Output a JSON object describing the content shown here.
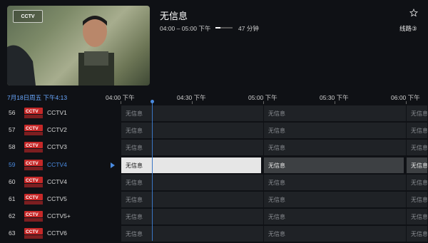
{
  "player": {
    "title": "无信息",
    "time_range": "04:00 – 05:00 下午",
    "progress_fraction": 0.3,
    "duration": "47 分钟",
    "line_label": "线路③",
    "star_icon": "star-outline-icon"
  },
  "timeline": {
    "date": "7月18日周五 下午4:13",
    "ticks": [
      "04:00 下午",
      "04:30 下午",
      "05:00 下午",
      "05:30 下午",
      "06:00 下午"
    ]
  },
  "channels": [
    {
      "num": "56",
      "logo_text": "CCTV1",
      "name": "CCTV1",
      "active": false,
      "programs": [
        "无信息",
        "无信息",
        "无信息"
      ]
    },
    {
      "num": "57",
      "logo_text": "CCTV2",
      "name": "CCTV2",
      "active": false,
      "programs": [
        "无信息",
        "无信息",
        "无信息"
      ]
    },
    {
      "num": "58",
      "logo_text": "CCTV3",
      "name": "CCTV3",
      "active": false,
      "programs": [
        "无信息",
        "无信息",
        "无信息"
      ]
    },
    {
      "num": "59",
      "logo_text": "CCTV4",
      "name": "CCTV4",
      "active": true,
      "programs": [
        "无信息",
        "无信息",
        "无信息"
      ]
    },
    {
      "num": "60",
      "logo_text": "CCTV4",
      "name": "CCTV4",
      "active": false,
      "programs": [
        "无信息",
        "无信息",
        "无信息"
      ]
    },
    {
      "num": "61",
      "logo_text": "CCTV5",
      "name": "CCTV5",
      "active": false,
      "programs": [
        "无信息",
        "无信息",
        "无信息"
      ]
    },
    {
      "num": "62",
      "logo_text": "CCTV5+",
      "name": "CCTV5+",
      "active": false,
      "programs": [
        "无信息",
        "无信息",
        "无信息"
      ]
    },
    {
      "num": "63",
      "logo_text": "CCTV6",
      "name": "CCTV6",
      "active": false,
      "programs": [
        "无信息",
        "无信息",
        "无信息"
      ]
    }
  ],
  "colors": {
    "accent": "#4a8be0",
    "background": "#0f1115",
    "cell": "#1f2226",
    "selected_cell": "#e6e6e6"
  }
}
